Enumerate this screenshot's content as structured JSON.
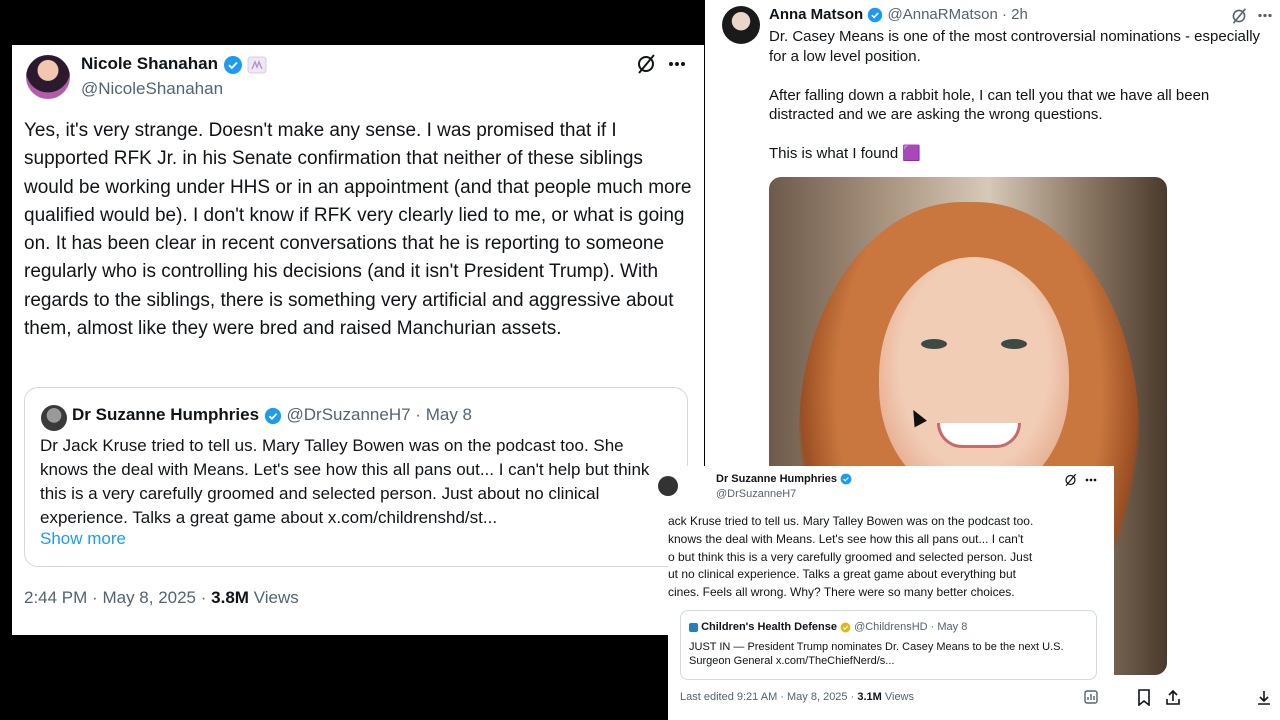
{
  "left_tweet": {
    "author_name": "Nicole Shanahan",
    "author_handle": "@NicoleShanahan",
    "body": "Yes, it's very strange. Doesn't make any sense. I was promised that if I supported RFK Jr. in his Senate confirmation that neither of these siblings would be working under HHS or in an appointment (and that people much more qualified would be). I don't know if RFK very clearly lied to me, or what is going on. It has been clear in recent conversations that he is reporting to someone regularly who is controlling his decisions (and it isn't President Trump). With regards to the siblings, there is something very artificial and aggressive about them, almost like they were bred and raised Manchurian assets.",
    "quote": {
      "author_name": "Dr Suzanne Humphries",
      "author_handle": "@DrSuzanneH7",
      "date": "May 8",
      "body": "Dr Jack Kruse tried to tell us. Mary Talley Bowen was on the podcast too. She knows the deal with Means. Let's see how this all pans out... I can't help but think this is a very carefully groomed and selected person. Just about no clinical experience. Talks a great game about x.com/childrenshd/st...",
      "show_more": "Show more"
    },
    "time": "2:44 PM",
    "date": "May 8, 2025",
    "views_count": "3.8M",
    "views_label": "Views"
  },
  "right_tweet": {
    "author_name": "Anna Matson",
    "author_handle": "@AnnaRMatson",
    "age": "2h",
    "paragraph_1": "Dr. Casey Means is one of the most controversial nominations - especially for a low level position.",
    "paragraph_2": "After falling down a rabbit hole, I can tell you that we have all been distracted and we are asking the wrong questions.",
    "paragraph_3": "This is what I found",
    "emoji": "🟪"
  },
  "overlay_tweet": {
    "author_name": "Dr Suzanne Humphries",
    "author_handle": "@DrSuzanneH7",
    "body_lines": [
      "ack Kruse tried to tell us. Mary Talley Bowen was on the podcast too.",
      "knows the deal with Means. Let's see how this all pans out... I can't",
      "o but think this is a very carefully groomed and selected person. Just",
      "ut no clinical experience. Talks a great game about everything but",
      "cines. Feels all wrong. Why? There were so many better choices."
    ],
    "quote": {
      "author_name": "Children's Health Defense",
      "author_handle": "@ChildrensHD",
      "date": "May 8",
      "body": "JUST IN — President Trump nominates Dr. Casey Means to be the next U.S. Surgeon General x.com/TheChiefNerd/s..."
    },
    "footer_prefix": "Last edited 9:21 AM · May 8, 2025 ·",
    "views_count": "3.1M",
    "views_label": "Views"
  },
  "colors": {
    "verified": "#1d9bf0",
    "link": "#1d9bf0",
    "muted": "#536471",
    "text": "#0f1419"
  }
}
